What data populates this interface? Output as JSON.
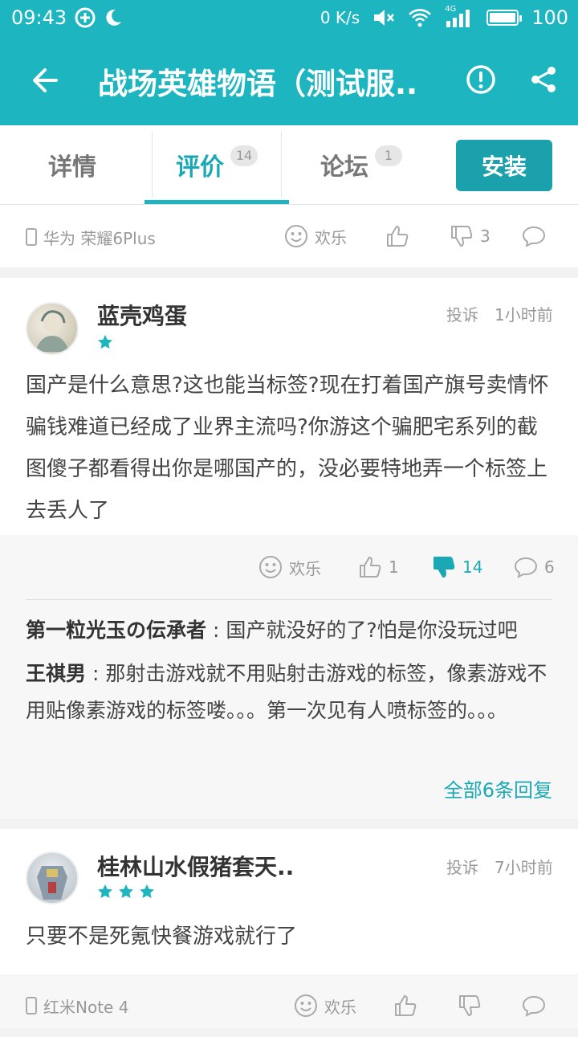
{
  "status_bar": {
    "time": "09:43",
    "network_speed": "0 K/s",
    "net_type": "4G",
    "battery": "100"
  },
  "app_bar": {
    "title": "战场英雄物语（测试服..",
    "back_icon": "arrow-left-icon",
    "warn_icon": "exclamation-circle-icon",
    "share_icon": "share-icon"
  },
  "tabs": [
    {
      "label": "详情",
      "badge": ""
    },
    {
      "label": "评价",
      "badge": "14",
      "active": true
    },
    {
      "label": "论坛",
      "badge": "1"
    }
  ],
  "install_label": "安装",
  "top_bar": {
    "device": "华为 荣耀6Plus",
    "joy_label": "欢乐",
    "down_count": "3"
  },
  "review1": {
    "username": "蓝壳鸡蛋",
    "stars": 1,
    "report": "投诉",
    "time": "1小时前",
    "content": "国产是什么意思?这也能当标签?现在打着国产旗号卖情怀骗钱难道已经成了业界主流吗?你游这个骗肥宅系列的截图傻子都看得出你是哪国产的，没必要特地弄一个标签上去丢人了",
    "joy_label": "欢乐",
    "up_count": "1",
    "down_count": "14",
    "comment_count": "6",
    "replies": [
      {
        "user": "第一粒光玉の伝承者",
        "text": " : 国产就没好的了?怕是你没玩过吧"
      },
      {
        "user": "王祺男",
        "text": " : 那射击游戏就不用贴射击游戏的标签，像素游戏不用贴像素游戏的标签喽。。。第一次见有人喷标签的。。。"
      }
    ],
    "more_replies": "全部6条回复"
  },
  "review2": {
    "username": "桂林山水假猪套天..",
    "stars": 3,
    "report": "投诉",
    "time": "7小时前",
    "content": "只要不是死氪快餐游戏就行了",
    "device": "红米Note 4",
    "joy_label": "欢乐"
  },
  "colors": {
    "accent": "#1db5c0",
    "install": "#1aa1ab",
    "text": "#444444",
    "muted": "#999999"
  }
}
